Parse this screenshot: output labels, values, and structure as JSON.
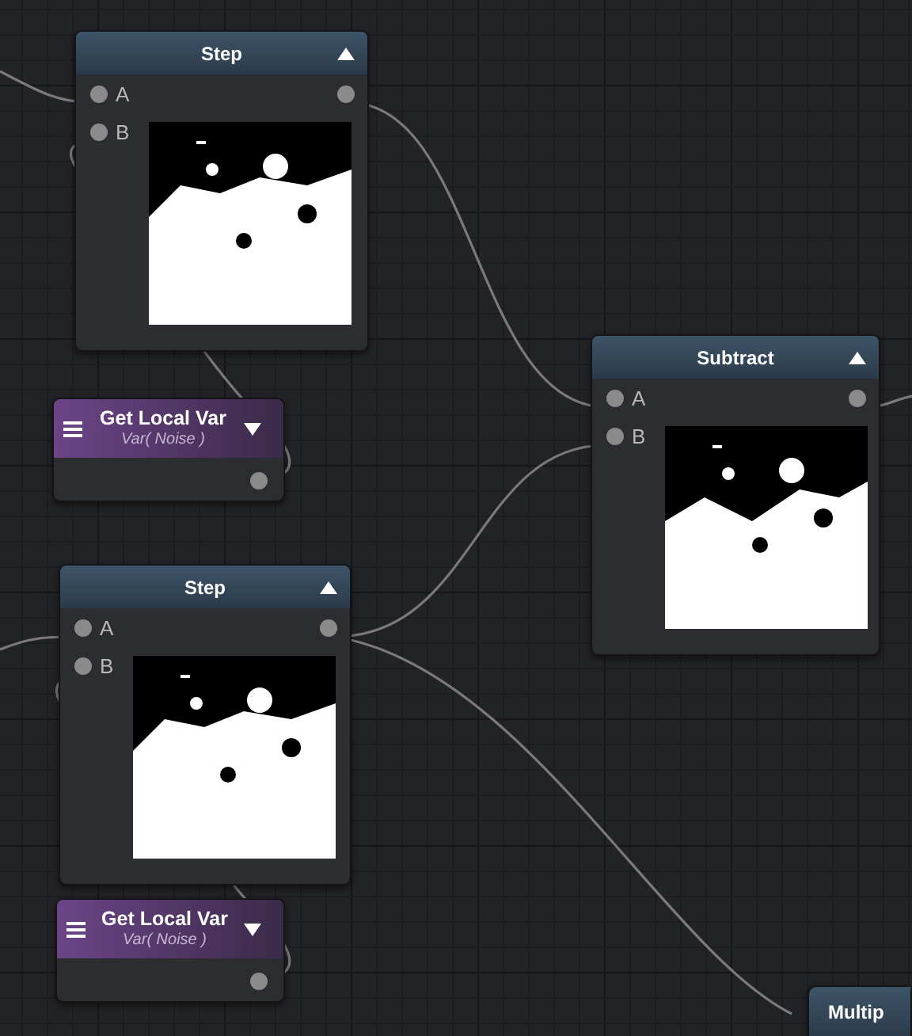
{
  "nodes": [
    {
      "kind": "operator",
      "title": "Step",
      "inputs": [
        "A",
        "B"
      ]
    },
    {
      "kind": "variable",
      "title": "Get Local Var",
      "subtitle": "Var( Noise )"
    },
    {
      "kind": "operator",
      "title": "Subtract",
      "inputs": [
        "A",
        "B"
      ]
    },
    {
      "kind": "operator",
      "title": "Step",
      "inputs": [
        "A",
        "B"
      ]
    },
    {
      "kind": "variable",
      "title": "Get Local Var",
      "subtitle": "Var( Noise )"
    },
    {
      "kind": "partial",
      "title": "Multip"
    }
  ]
}
